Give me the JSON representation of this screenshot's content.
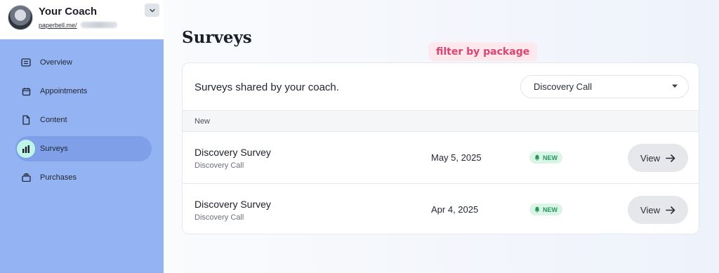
{
  "sidebar": {
    "coach_name": "Your Coach",
    "coach_url": "paperbell.me/",
    "items": [
      {
        "label": "Overview",
        "icon": "overview-icon"
      },
      {
        "label": "Appointments",
        "icon": "calendar-icon"
      },
      {
        "label": "Content",
        "icon": "document-icon"
      },
      {
        "label": "Surveys",
        "icon": "bar-chart-icon",
        "active": true
      },
      {
        "label": "Purchases",
        "icon": "purchases-icon"
      }
    ]
  },
  "main": {
    "title": "Surveys",
    "tooltip": "filter by package",
    "card_heading": "Surveys shared by your coach.",
    "filter": {
      "selected": "Discovery Call"
    },
    "section_label": "New",
    "rows": [
      {
        "title": "Discovery Survey",
        "subtitle": "Discovery Call",
        "date": "May 5, 2025",
        "badge": "NEW",
        "action": "View"
      },
      {
        "title": "Discovery Survey",
        "subtitle": "Discovery Call",
        "date": "Apr 4, 2025",
        "badge": "NEW",
        "action": "View"
      }
    ]
  },
  "colors": {
    "sidebar": "#93b3f2",
    "active_item": "#7fa0e8",
    "active_icon_bg": "#bff5e8",
    "accent_pink": "#e2426f",
    "badge_green": "#22995a"
  }
}
